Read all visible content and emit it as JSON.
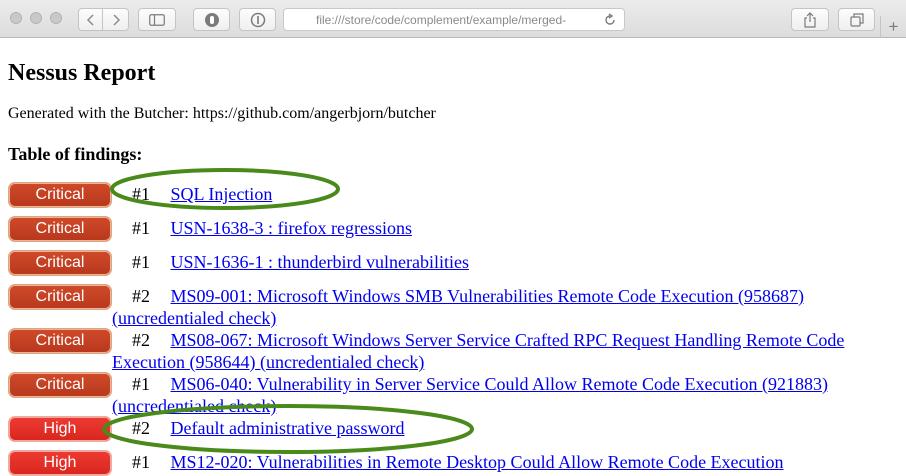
{
  "browser": {
    "url": "file:///store/code/complement/example/merged-",
    "new_tab_label": "+"
  },
  "page": {
    "title": "Nessus Report",
    "generated_line": "Generated with the Butcher: https://github.com/angerbjorn/butcher",
    "table_heading": "Table of findings:"
  },
  "colors": {
    "critical": "#c2401f",
    "high": "#e2302a",
    "link": "#0000ee",
    "annotation": "#4a8a1a"
  },
  "findings": [
    {
      "severity": "Critical",
      "num": "#1",
      "title": "SQL Injection"
    },
    {
      "severity": "Critical",
      "num": "#1",
      "title": "USN-1638-3 : firefox regressions"
    },
    {
      "severity": "Critical",
      "num": "#1",
      "title": "USN-1636-1 : thunderbird vulnerabilities"
    },
    {
      "severity": "Critical",
      "num": "#2",
      "title": "MS09-001: Microsoft Windows SMB Vulnerabilities Remote Code Execution (958687) (uncredentialed check)"
    },
    {
      "severity": "Critical",
      "num": "#2",
      "title": "MS08-067: Microsoft Windows Server Service Crafted RPC Request Handling Remote Code Execution (958644) (uncredentialed check)"
    },
    {
      "severity": "Critical",
      "num": "#1",
      "title": "MS06-040: Vulnerability in Server Service Could Allow Remote Code Execution (921883) (uncredentialed check)"
    },
    {
      "severity": "High",
      "num": "#2",
      "title": "Default administrative password"
    },
    {
      "severity": "High",
      "num": "#1",
      "title": "MS12-020: Vulnerabilities in Remote Desktop Could Allow Remote Code Execution"
    }
  ]
}
